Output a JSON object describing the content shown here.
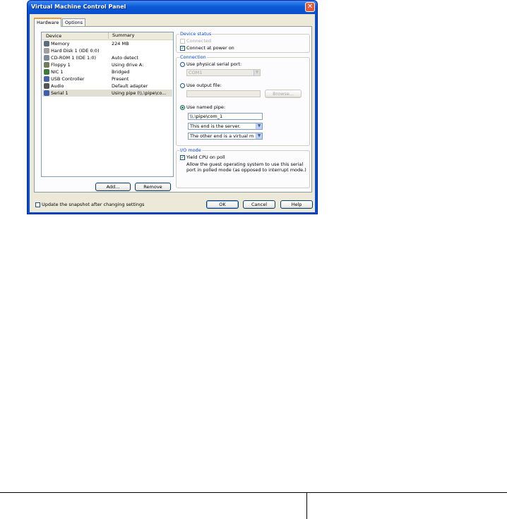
{
  "window": {
    "title": "Virtual Machine Control Panel",
    "close_glyph": "✕"
  },
  "tabs": [
    "Hardware",
    "Options"
  ],
  "device_list": {
    "columns": [
      "Device",
      "Summary"
    ],
    "rows": [
      {
        "device": "Memory",
        "summary": "224 MB",
        "icon": "memory-icon",
        "color": "#5a6b7a"
      },
      {
        "device": "Hard Disk 1 (IDE 0:0)",
        "summary": "",
        "icon": "hard-disk-icon",
        "color": "#9aa0a6"
      },
      {
        "device": "CD-ROM 1 (IDE 1:0)",
        "summary": "Auto detect",
        "icon": "cdrom-icon",
        "color": "#7a8a99"
      },
      {
        "device": "Floppy 1",
        "summary": "Using drive A:",
        "icon": "floppy-icon",
        "color": "#6f7d5a"
      },
      {
        "device": "NIC 1",
        "summary": "Bridged",
        "icon": "nic-icon",
        "color": "#3d7a3d"
      },
      {
        "device": "USB Controller",
        "summary": "Present",
        "icon": "usb-icon",
        "color": "#4b5ea8"
      },
      {
        "device": "Audio",
        "summary": "Default adapter",
        "icon": "audio-icon",
        "color": "#555555"
      },
      {
        "device": "Serial 1",
        "summary": "Using pipe (\\\\.\\pipe\\co...",
        "icon": "serial-port-icon",
        "color": "#3f5fa8",
        "selected": true
      }
    ]
  },
  "buttons": {
    "add": "Add...",
    "remove": "Remove",
    "ok": "OK",
    "cancel": "Cancel",
    "help": "Help",
    "browse": "Browse..."
  },
  "device_status": {
    "label": "Device status",
    "connected": "Connected",
    "connect_at_power_on": "Connect at power on"
  },
  "connection": {
    "label": "Connection",
    "use_physical": "Use physical serial port:",
    "physical_value": "COM1",
    "use_output_file": "Use output file:",
    "output_file_value": "",
    "use_named_pipe": "Use named pipe:",
    "pipe_name": "\\\\.\\pipe\\com_1",
    "end_role": "This end is the server.",
    "other_end": "The other end is a virtual m"
  },
  "io_mode": {
    "label": "I/O mode",
    "yield_cpu": "Yield CPU on poll",
    "description": "Allow the guest operating system to use this serial port in polled mode (as opposed to interrupt mode.)"
  },
  "footer": {
    "update_snapshot": "Update the snapshot after changing settings"
  },
  "checks": {
    "connected": false,
    "connect_at_power_on": true,
    "yield_cpu": true,
    "update_snapshot": false
  },
  "dropdown_glyph": "▼"
}
